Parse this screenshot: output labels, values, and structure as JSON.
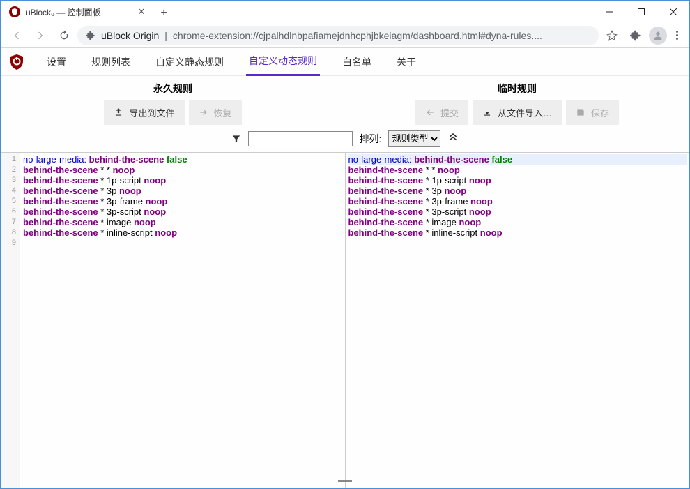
{
  "browser": {
    "tab_title": "uBlock₀ — 控制面板",
    "address_origin": "uBlock Origin",
    "address_path": "chrome-extension://cjpalhdlnbpafiamejdnhcphjbkeiagm/dashboard.html#dyna-rules...."
  },
  "tabs": {
    "settings": "设置",
    "filter_lists": "规则列表",
    "static_rules": "自定义静态规则",
    "dynamic_rules": "自定义动态规则",
    "whitelist": "白名单",
    "about": "关于"
  },
  "headers": {
    "permanent": "永久规则",
    "temporary": "临时规则"
  },
  "buttons": {
    "export": "导出到文件",
    "revert": "恢复",
    "commit": "提交",
    "import": "从文件导入…",
    "save": "保存"
  },
  "filter": {
    "sort_label": "排列:",
    "sort_value": "规则类型"
  },
  "rules_left": [
    {
      "key": "no-large-media:",
      "dom": "behind-the-scene",
      "val": "false"
    },
    {
      "dom": "behind-the-scene",
      "mid": "* *",
      "act": "noop"
    },
    {
      "dom": "behind-the-scene",
      "mid": "* 1p-script",
      "act": "noop"
    },
    {
      "dom": "behind-the-scene",
      "mid": "* 3p",
      "act": "noop"
    },
    {
      "dom": "behind-the-scene",
      "mid": "* 3p-frame",
      "act": "noop"
    },
    {
      "dom": "behind-the-scene",
      "mid": "* 3p-script",
      "act": "noop"
    },
    {
      "dom": "behind-the-scene",
      "mid": "* image",
      "act": "noop"
    },
    {
      "dom": "behind-the-scene",
      "mid": "* inline-script",
      "act": "noop"
    }
  ],
  "rules_right": [
    {
      "key": "no-large-media:",
      "dom": "behind-the-scene",
      "val": "false",
      "hl": true
    },
    {
      "dom": "behind-the-scene",
      "mid": "* *",
      "act": "noop"
    },
    {
      "dom": "behind-the-scene",
      "mid": "* 1p-script",
      "act": "noop"
    },
    {
      "dom": "behind-the-scene",
      "mid": "* 3p",
      "act": "noop"
    },
    {
      "dom": "behind-the-scene",
      "mid": "* 3p-frame",
      "act": "noop"
    },
    {
      "dom": "behind-the-scene",
      "mid": "* 3p-script",
      "act": "noop"
    },
    {
      "dom": "behind-the-scene",
      "mid": "* image",
      "act": "noop"
    },
    {
      "dom": "behind-the-scene",
      "mid": "* inline-script",
      "act": "noop"
    }
  ],
  "left_line_count": 9
}
